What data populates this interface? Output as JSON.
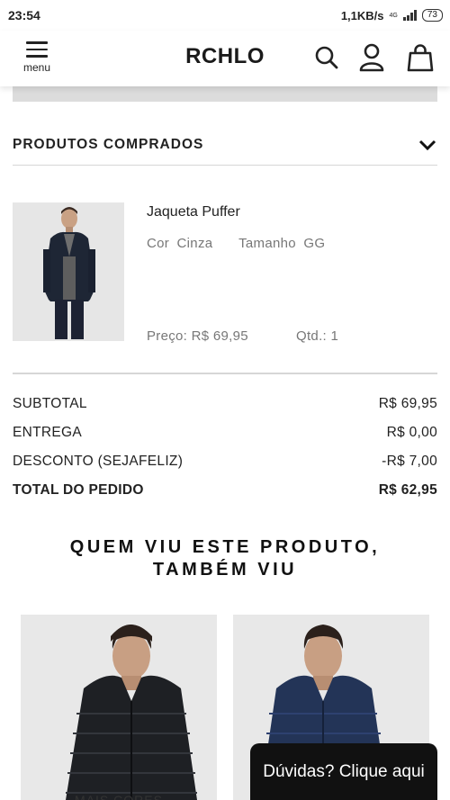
{
  "status_bar": {
    "time": "23:54",
    "speed": "1,1KB/s",
    "network": "4G",
    "battery": "73"
  },
  "header": {
    "menu_label": "menu",
    "logo": "RCHLO",
    "icons": [
      "search-icon",
      "user-icon",
      "bag-icon"
    ]
  },
  "purchased": {
    "title": "PRODUTOS COMPRADOS",
    "product": {
      "name": "Jaqueta Puffer",
      "color_label": "Cor",
      "color_value": "Cinza",
      "size_label": "Tamanho",
      "size_value": "GG",
      "price_label": "Preço:",
      "price_value": "R$ 69,95",
      "qty_label": "Qtd.:",
      "qty_value": "1"
    }
  },
  "summary": {
    "rows": [
      {
        "label": "SUBTOTAL",
        "value": "R$ 69,95"
      },
      {
        "label": "ENTREGA",
        "value": "R$ 0,00"
      },
      {
        "label": "DESCONTO (SEJAFELIZ)",
        "value": "-R$ 7,00"
      },
      {
        "label": "TOTAL DO PEDIDO",
        "value": "R$ 62,95"
      }
    ]
  },
  "recommendations": {
    "title_line1": "QUEM VIU ESTE PRODUTO,",
    "title_line2": "TAMBÉM VIU",
    "first_card_label": "MAIS CORES"
  },
  "help_button": "Dúvidas? Clique aqui",
  "colors": {
    "jacket_black": "#1e2024",
    "jacket_navy": "#233457",
    "help_bg": "#111111"
  }
}
